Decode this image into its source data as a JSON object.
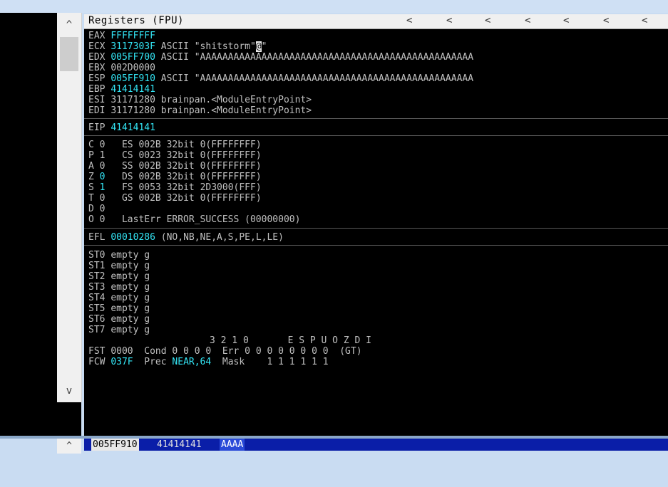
{
  "header": {
    "title": "Registers (FPU)",
    "chevron": "<"
  },
  "scroll": {
    "up": "^",
    "down": "v"
  },
  "registers": [
    {
      "name": "EAX",
      "value": "FFFFFFFF",
      "comment": ""
    },
    {
      "name": "ECX",
      "value": "3117303F",
      "comment": "ASCII \"shitstorm\"",
      "hl": "@",
      "tail": "\""
    },
    {
      "name": "EDX",
      "value": "005FF700",
      "comment": "ASCII \"AAAAAAAAAAAAAAAAAAAAAAAAAAAAAAAAAAAAAAAAAAAAAAAAA"
    },
    {
      "name": "EBX",
      "value": "002D0000",
      "comment": ""
    },
    {
      "name": "ESP",
      "value": "005FF910",
      "comment": "ASCII \"AAAAAAAAAAAAAAAAAAAAAAAAAAAAAAAAAAAAAAAAAAAAAAAAA"
    },
    {
      "name": "EBP",
      "value": "41414141",
      "comment": ""
    },
    {
      "name": "ESI",
      "value": "31171280",
      "comment": "brainpan.<ModuleEntryPoint>"
    },
    {
      "name": "EDI",
      "value": "31171280",
      "comment": "brainpan.<ModuleEntryPoint>"
    }
  ],
  "eip": {
    "name": "EIP",
    "value": "41414141"
  },
  "flags": [
    {
      "flag": "C",
      "bit": "0",
      "seg": "ES",
      "sel": "002B",
      "bits": "32bit",
      "base": "0(FFFFFFFF)"
    },
    {
      "flag": "P",
      "bit": "1",
      "seg": "CS",
      "sel": "0023",
      "bits": "32bit",
      "base": "0(FFFFFFFF)"
    },
    {
      "flag": "A",
      "bit": "0",
      "seg": "SS",
      "sel": "002B",
      "bits": "32bit",
      "base": "0(FFFFFFFF)"
    },
    {
      "flag": "Z",
      "bit": "0",
      "seg": "DS",
      "sel": "002B",
      "bits": "32bit",
      "base": "0(FFFFFFFF)"
    },
    {
      "flag": "S",
      "bit": "1",
      "seg": "FS",
      "sel": "0053",
      "bits": "32bit",
      "base": "2D3000(FFF)"
    },
    {
      "flag": "T",
      "bit": "0",
      "seg": "GS",
      "sel": "002B",
      "bits": "32bit",
      "base": "0(FFFFFFFF)"
    },
    {
      "flag": "D",
      "bit": "0"
    },
    {
      "flag": "O",
      "bit": "0",
      "lasterr": "LastErr ERROR_SUCCESS (00000000)"
    }
  ],
  "efl": {
    "name": "EFL",
    "value": "00010286",
    "desc": "(NO,NB,NE,A,S,PE,L,LE)"
  },
  "fpu": [
    {
      "name": "ST0",
      "value": "empty g"
    },
    {
      "name": "ST1",
      "value": "empty g"
    },
    {
      "name": "ST2",
      "value": "empty g"
    },
    {
      "name": "ST3",
      "value": "empty g"
    },
    {
      "name": "ST4",
      "value": "empty g"
    },
    {
      "name": "ST5",
      "value": "empty g"
    },
    {
      "name": "ST6",
      "value": "empty g"
    },
    {
      "name": "ST7",
      "value": "empty g"
    }
  ],
  "fst_header": "3 2 1 0       E S P U O Z D I",
  "fst": {
    "name": "FST",
    "value": "0000",
    "cond": "Cond 0 0 0 0",
    "err": "Err 0 0 0 0 0 0 0 0",
    "tail": "(GT)"
  },
  "fcw": {
    "name": "FCW",
    "value": "037F",
    "prec_label": "Prec",
    "prec": "NEAR,64",
    "mask": "Mask    1 1 1 1 1 1"
  },
  "stack": {
    "addr": "005FF910",
    "value": "41414141",
    "ascii": "AAAA"
  },
  "colors": {
    "cyan": "#33e6f6",
    "gray": "#c0c0c0",
    "bg": "#000000"
  }
}
